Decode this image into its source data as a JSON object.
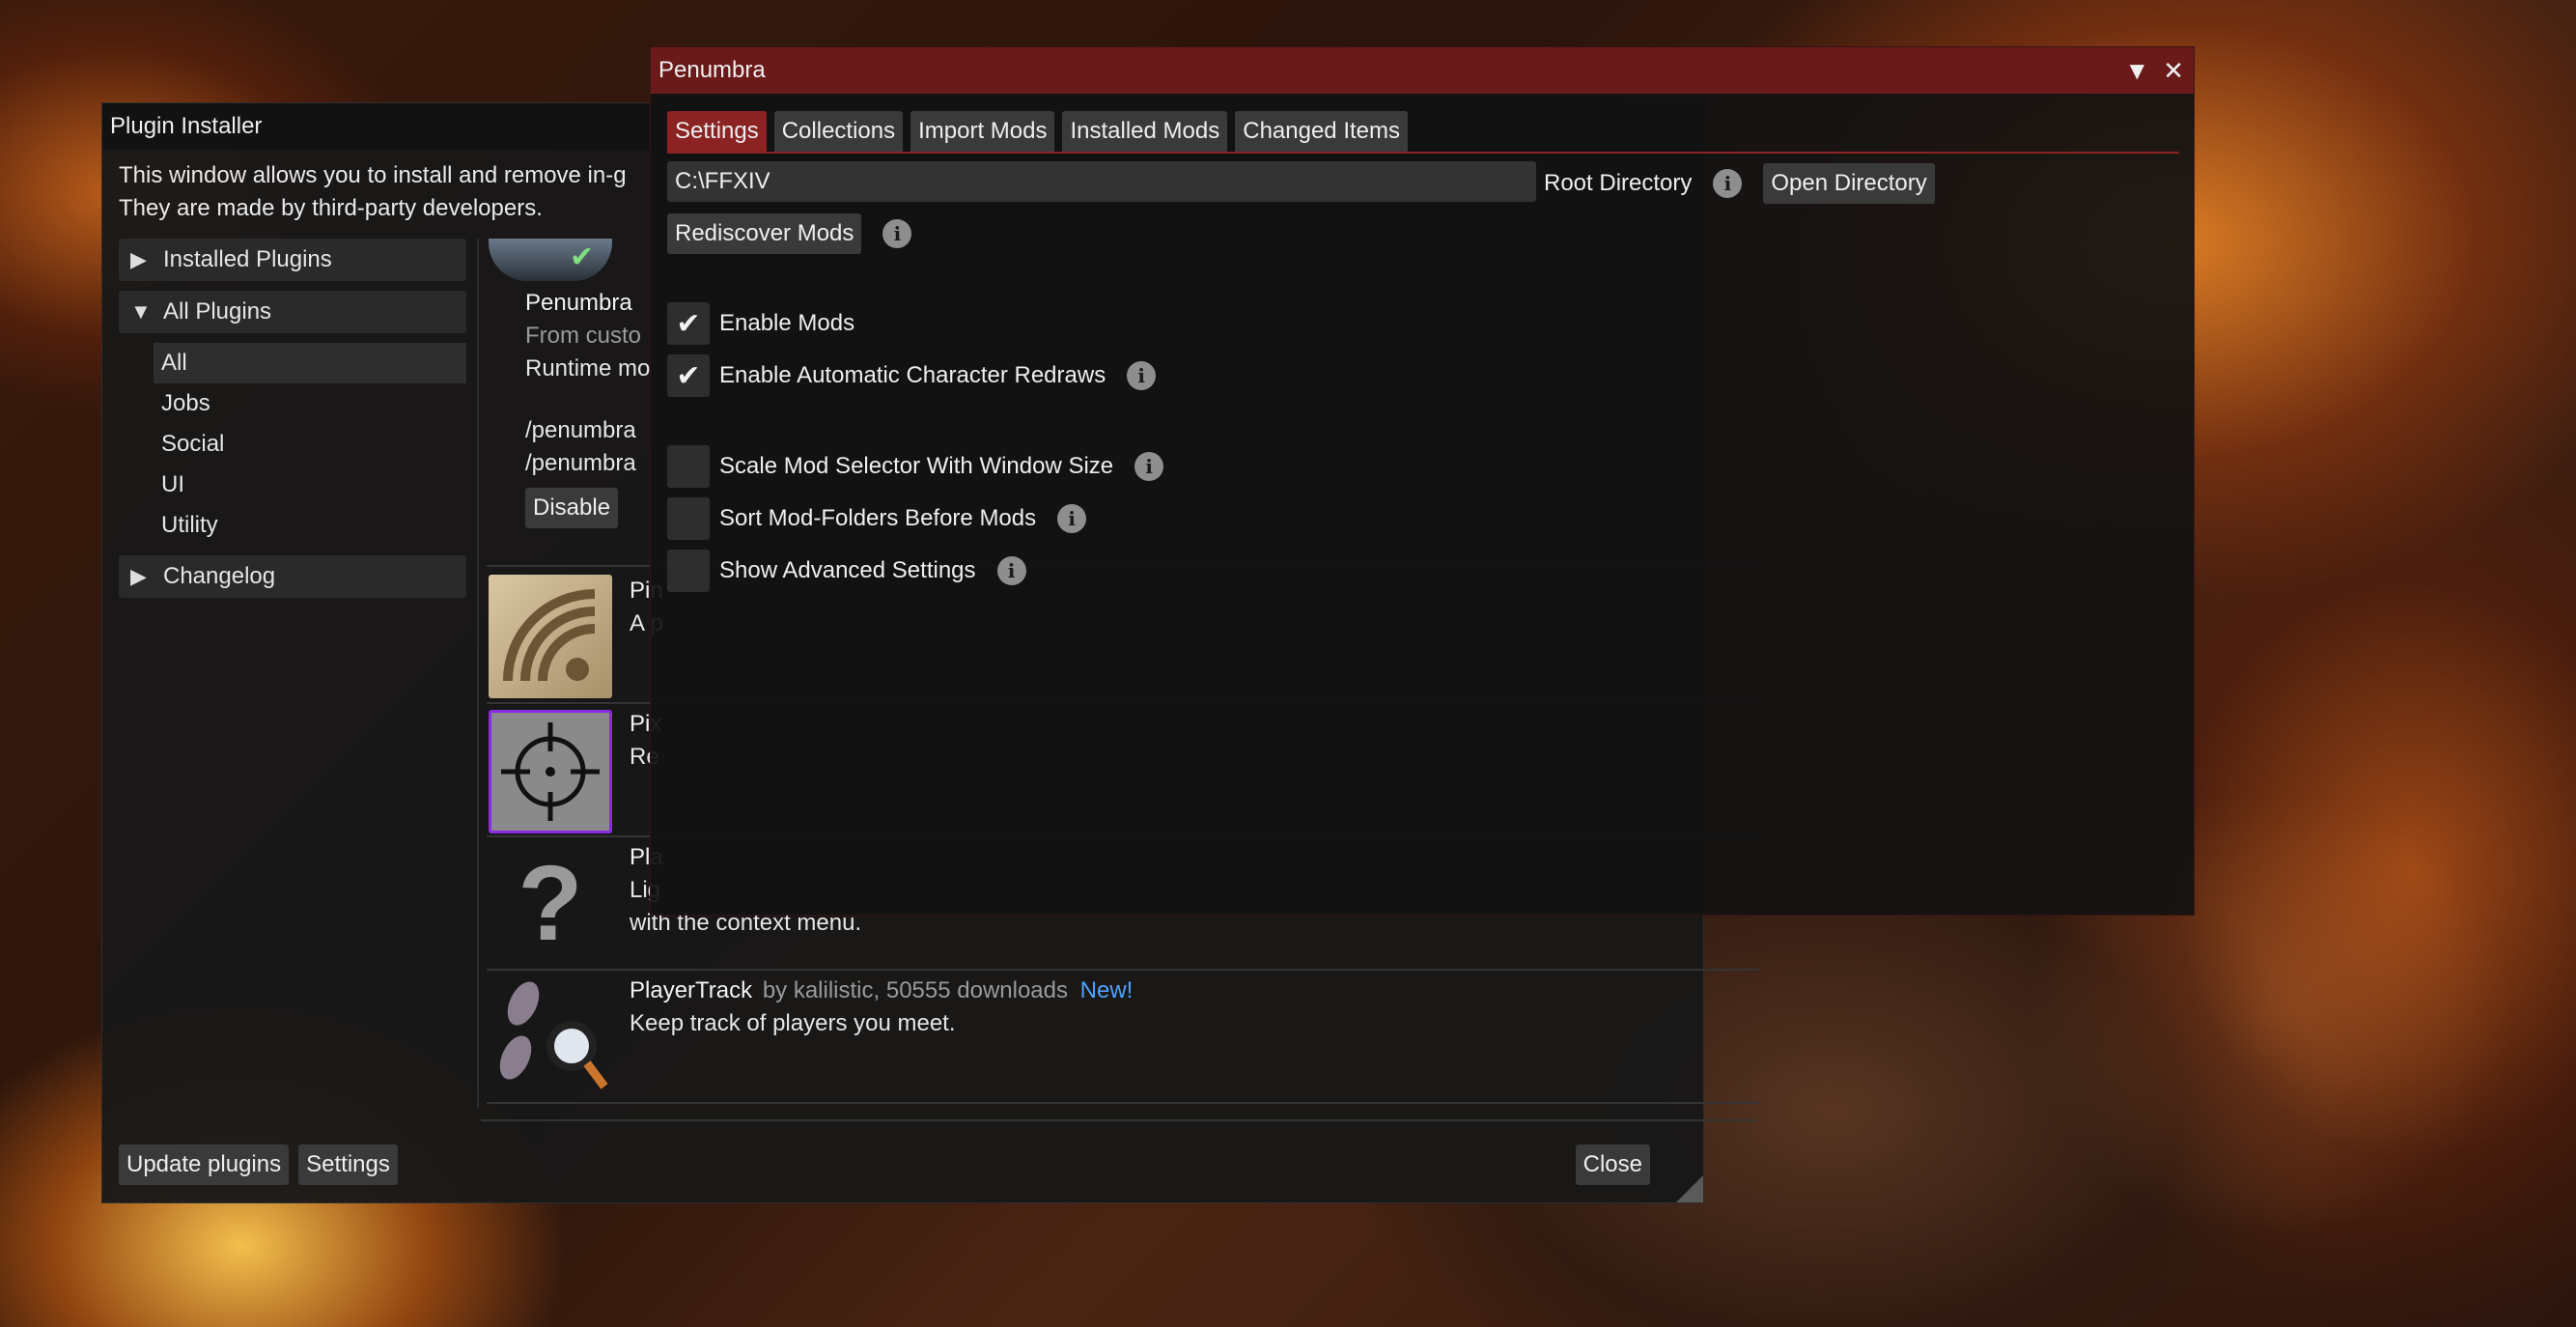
{
  "installer": {
    "title": "Plugin Installer",
    "intro_line1": "This window allows you to install and remove in-g",
    "intro_line2": "They are made by third-party developers.",
    "categories": {
      "installed": "Installed Plugins",
      "all": "All Plugins",
      "items": [
        "All",
        "Jobs",
        "Social",
        "UI",
        "Utility"
      ],
      "changelog": "Changelog"
    },
    "plugins": {
      "penumbra": {
        "name": "Penumbra",
        "from": "From custo",
        "runtime": "Runtime mo",
        "cmd1": "/penumbra",
        "cmd2": "/penumbra",
        "disable": "Disable"
      },
      "ping": {
        "name": "Pin",
        "desc": "A p"
      },
      "pixel": {
        "name": "Pix",
        "desc": "Re"
      },
      "tags": {
        "name": "Pla",
        "desc": "Lig",
        "desc2": "with the context menu."
      },
      "playertrack": {
        "name": "PlayerTrack",
        "by": "by kalilistic, 50555 downloads",
        "new": "New!",
        "desc": "Keep track of players you meet."
      }
    },
    "footer": {
      "update": "Update plugins",
      "settings": "Settings",
      "close": "Close"
    }
  },
  "penumbra": {
    "title": "Penumbra",
    "tabs": [
      "Settings",
      "Collections",
      "Import Mods",
      "Installed Mods",
      "Changed Items"
    ],
    "root_value": "C:\\FFXIV",
    "root_label": "Root Directory",
    "open_dir": "Open Directory",
    "rediscover": "Rediscover Mods",
    "options": {
      "enable_mods": "Enable Mods",
      "auto_redraw": "Enable Automatic Character Redraws",
      "scale_selector": "Scale Mod Selector With Window Size",
      "sort_folders": "Sort Mod-Folders Before Mods",
      "advanced": "Show Advanced Settings"
    },
    "checked": {
      "enable_mods": true,
      "auto_redraw": true,
      "scale_selector": false,
      "sort_folders": false,
      "advanced": false
    }
  },
  "icons": {
    "info": "i",
    "check": "✔",
    "collapse": "▼",
    "close": "✕",
    "tri_right": "▶",
    "tri_down": "▼"
  },
  "colors": {
    "accent": "#8b2323",
    "titlebar": "#6b1a1a",
    "new_badge": "#4da3ff"
  }
}
